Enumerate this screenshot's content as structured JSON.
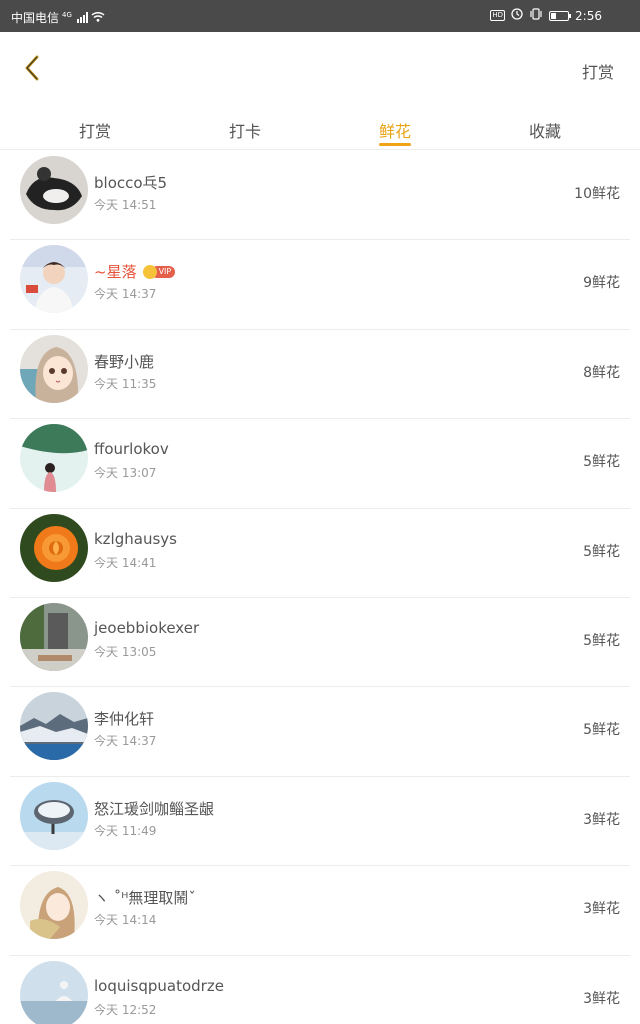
{
  "statusbar": {
    "carrier": "中国电信",
    "signal_tag": "4G",
    "hd": "HD",
    "time": "2:56"
  },
  "header": {
    "action_label": "打赏"
  },
  "tabs": [
    {
      "label": "打赏",
      "active": false
    },
    {
      "label": "打卡",
      "active": false
    },
    {
      "label": "鲜花",
      "active": true
    },
    {
      "label": "收藏",
      "active": false
    }
  ],
  "accent_color": "#f0a415",
  "vip_badge_label": "VIP",
  "records": [
    {
      "name": "blocco乓5",
      "time": "今天 14:51",
      "count": "10鲜花"
    },
    {
      "name": "~星落",
      "time": "今天 14:37",
      "count": "9鲜花",
      "vip": true
    },
    {
      "name": "春野小鹿",
      "time": "今天 11:35",
      "count": "8鲜花"
    },
    {
      "name": "ffourlokov",
      "time": "今天 13:07",
      "count": "5鲜花"
    },
    {
      "name": "kzlghausys",
      "time": "今天 14:41",
      "count": "5鲜花"
    },
    {
      "name": "jeoebbiokexer",
      "time": "今天 13:05",
      "count": "5鲜花"
    },
    {
      "name": "李仲化轩",
      "time": "今天 14:37",
      "count": "5鲜花"
    },
    {
      "name": "怒江瑗剑咖鲻圣龈",
      "time": "今天 11:49",
      "count": "3鲜花"
    },
    {
      "name": "ヽ ˚ᴴ無理取鬧ˇ",
      "time": "今天 14:14",
      "count": "3鲜花"
    },
    {
      "name": "loquisqpuatodrze",
      "time": "今天 12:52",
      "count": "3鲜花"
    }
  ]
}
